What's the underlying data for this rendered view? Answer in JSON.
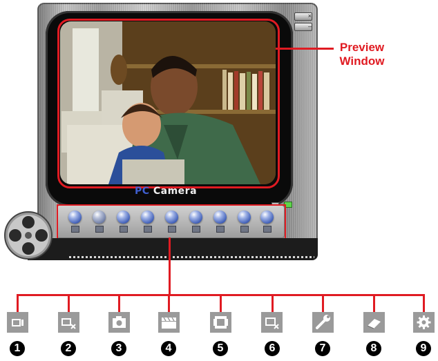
{
  "window": {
    "brand_pc": "PC",
    "brand_camera": "Camera",
    "close_glyph": "×",
    "minimize_glyph": "–"
  },
  "callout": {
    "line1": "Preview",
    "line2": "Window"
  },
  "toolbar": {
    "buttons": [
      {
        "icon": "video-camera-icon"
      },
      {
        "icon": "video-camera-off-icon"
      },
      {
        "icon": "snapshot-camera-icon"
      },
      {
        "icon": "clapperboard-icon"
      },
      {
        "icon": "video-frame-icon"
      },
      {
        "icon": "screen-close-icon"
      },
      {
        "icon": "wrench-icon"
      },
      {
        "icon": "eraser-icon"
      },
      {
        "icon": "gear-icon"
      }
    ]
  },
  "legend": {
    "numbers": [
      "1",
      "2",
      "3",
      "4",
      "5",
      "6",
      "7",
      "8",
      "9"
    ],
    "icons": [
      "video-camera-icon",
      "video-camera-off-icon",
      "snapshot-camera-icon",
      "clapperboard-icon",
      "video-frame-icon",
      "screen-close-icon",
      "wrench-icon",
      "eraser-icon",
      "gear-icon"
    ]
  },
  "colors": {
    "callout_red": "#e01b22",
    "brand_blue": "#3f5fd0",
    "led_green": "#5ed54a"
  }
}
